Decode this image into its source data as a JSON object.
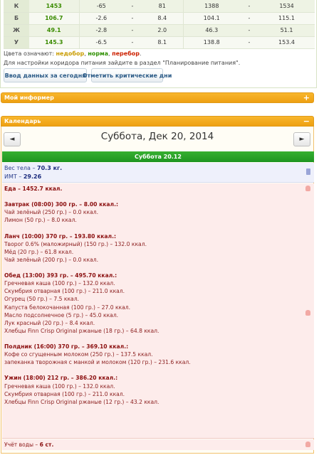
{
  "nutrients": [
    {
      "label": "К",
      "value": "1453",
      "min": "-65",
      "dash1": "-",
      "max": "81",
      "low": "1388",
      "dash2": "-",
      "high": "1534"
    },
    {
      "label": "Б",
      "value": "106.7",
      "min": "-2.6",
      "dash1": "-",
      "max": "8.4",
      "low": "104.1",
      "dash2": "-",
      "high": "115.1"
    },
    {
      "label": "Ж",
      "value": "49.1",
      "min": "-2.8",
      "dash1": "-",
      "max": "2.0",
      "low": "46.3",
      "dash2": "-",
      "high": "51.1"
    },
    {
      "label": "У",
      "value": "145.3",
      "min": "-6.5",
      "dash1": "-",
      "max": "8.1",
      "low": "138.8",
      "dash2": "-",
      "high": "153.4"
    }
  ],
  "legend": {
    "prefix": "Цвета означают: ",
    "under": "недобор",
    "sep1": ", ",
    "norm": "норма",
    "sep2": ", ",
    "over": "перебор",
    "suffix": "."
  },
  "hint": "Для настройки коридора питания зайдите в раздел \"Планирование питания\".",
  "buttons": {
    "entry": "Ввод данных за сегодня",
    "critical": "Отметить критические дни"
  },
  "panels": {
    "my_info": "Мой информер",
    "my_info_ctl": "+",
    "calendar": "Календарь",
    "calendar_ctl": "−"
  },
  "calendar": {
    "prev": "◄",
    "next": "►",
    "date": "Суббота, Дек 20, 2014",
    "day_label": "Суббота 20.12"
  },
  "body": {
    "weight_label": "Вес тела – ",
    "weight_value": "70.3 кг.",
    "bmi_label": "ИМТ – ",
    "bmi_value": "29.26"
  },
  "food": {
    "total": "Еда – 1452.7 ккал.",
    "meals": [
      {
        "title": "Завтрак (08:00) 300 гр. – 8.00 ккал.:",
        "items": [
          "Чай зелёный (250 гр.) – 0.0 ккал.",
          "Лимон (50 гр.) – 8.0 ккал."
        ]
      },
      {
        "title": "Ланч (10:00) 370 гр. – 193.80 ккал.:",
        "items": [
          "Творог 0.6% (маложирный) (150 гр.) – 132.0 ккал.",
          "Мёд (20 гр.) – 61.8 ккал.",
          "Чай зелёный (200 гр.) – 0.0 ккал."
        ]
      },
      {
        "title": "Обед (13:00) 393 гр. – 495.70 ккал.:",
        "items": [
          "Гречневая каша (100 гр.) – 132.0 ккал.",
          "Скумбрия отварная (100 гр.) – 211.0 ккал.",
          "Огурец (50 гр.) – 7.5 ккал.",
          "Капуста белокочанная (100 гр.) – 27.0 ккал.",
          "Масло подсолнечное (5 гр.) – 45.0 ккал.",
          "Лук красный (20 гр.) – 8.4 ккал.",
          "Хлебцы Finn Crisp Original ржаные (18 гр.) – 64.8 ккал."
        ]
      },
      {
        "title": "Полдник (16:00) 370 гр. – 369.10 ккал.:",
        "items": [
          "Кофе со сгущенным молоком (250 гр.) – 137.5 ккал.",
          "запеканка творожная с манкой и молоком (120 гр.) – 231.6 ккал."
        ]
      },
      {
        "title": "Ужин (18:00) 212 гр. – 386.20 ккал.:",
        "items": [
          "Гречневая каша (100 гр.) – 132.0 ккал.",
          "Скумбрия отварная (100 гр.) – 211.0 ккал.",
          "Хлебцы Finn Crisp Original ржаные (12 гр.) – 43.2 ккал."
        ]
      }
    ]
  },
  "water": {
    "label": "Учёт воды – ",
    "value": "6 ст."
  }
}
